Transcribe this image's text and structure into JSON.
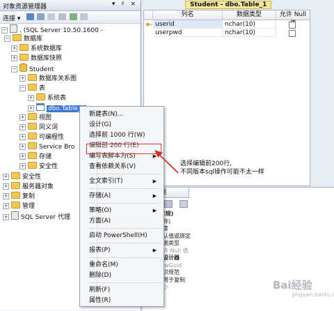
{
  "explorer": {
    "title": "对象资源管理器",
    "title_buttons": "▾ ♯ ×",
    "toolbar": {
      "connect_label": "连接 ▾"
    },
    "tree": [
      {
        "text": ". (SQL Server 10.50.1600 - ",
        "expander": "−",
        "icon": "server-icon"
      },
      {
        "text": "数据库",
        "expander": "−",
        "icon": "folder-icon"
      },
      {
        "text": "系统数据库",
        "expander": "+",
        "icon": "folder-icon"
      },
      {
        "text": "数据库快照",
        "expander": "+",
        "icon": "folder-icon"
      },
      {
        "text": "Student",
        "expander": "−",
        "icon": "database-icon"
      },
      {
        "text": "数据库关系图",
        "expander": "+",
        "icon": "folder-icon"
      },
      {
        "text": "表",
        "expander": "−",
        "icon": "folder-icon"
      },
      {
        "text": "系统表",
        "expander": "+",
        "icon": "folder-icon"
      },
      {
        "text": "dbo.Table_1",
        "expander": "+",
        "icon": "table-icon",
        "selected": true
      },
      {
        "text": "视图",
        "expander": "+",
        "icon": "folder-icon"
      },
      {
        "text": "同义词",
        "expander": "+",
        "icon": "folder-icon"
      },
      {
        "text": "可编程性",
        "expander": "+",
        "icon": "folder-icon"
      },
      {
        "text": "Service Bro",
        "expander": "+",
        "icon": "folder-icon"
      },
      {
        "text": "存储",
        "expander": "+",
        "icon": "folder-icon"
      },
      {
        "text": "安全性",
        "expander": "+",
        "icon": "folder-icon"
      },
      {
        "text": "安全性",
        "expander": "+",
        "icon": "folder-icon"
      },
      {
        "text": "服务器对象",
        "expander": "+",
        "icon": "folder-icon"
      },
      {
        "text": "复制",
        "expander": "+",
        "icon": "folder-icon"
      },
      {
        "text": "管理",
        "expander": "+",
        "icon": "folder-icon"
      },
      {
        "text": "SQL Server 代理",
        "expander": "+",
        "icon": "agent-icon"
      }
    ]
  },
  "designer": {
    "tab_title": "Student - dbo.Table_1",
    "columns": [
      "列名",
      "数据类型",
      "允许 Null 值"
    ],
    "rows": [
      {
        "name": "userid",
        "type": "nchar(10)",
        "key": true
      },
      {
        "name": "userpwd",
        "type": "nchar(10)",
        "key": false
      }
    ]
  },
  "props": {
    "tab_label": "性",
    "rows": [
      {
        "text": "(常规)",
        "style": "b"
      },
      {
        "text": "名称)",
        "style": ""
      },
      {
        "text": "长度",
        "style": ""
      },
      {
        "text": "默认值或绑定",
        "style": ""
      },
      {
        "text": "数据类型",
        "style": ""
      },
      {
        "text": "允许 Null 值",
        "style": "g"
      },
      {
        "text": "表设计器",
        "style": "b"
      },
      {
        "text": "RowGuid",
        "style": "g"
      },
      {
        "text": "标识规范",
        "style": ""
      },
      {
        "text": "不用于复制",
        "style": ""
      },
      {
        "text": "大小",
        "style": "g"
      }
    ]
  },
  "context_menu": {
    "items": [
      {
        "label": "新建表(N)...",
        "submenu": false
      },
      {
        "label": "设计(G)",
        "submenu": false
      },
      {
        "label": "选择前 1000 行(W)",
        "submenu": false
      },
      {
        "label": "编辑前 200 行(E)",
        "submenu": false,
        "highlighted": true
      },
      {
        "label": "编写表脚本为(S)",
        "submenu": true
      },
      {
        "label": "查看依赖关系(V)",
        "submenu": false
      },
      {
        "sep": true
      },
      {
        "label": "全文索引(T)",
        "submenu": true
      },
      {
        "sep": true
      },
      {
        "label": "存储(A)",
        "submenu": true
      },
      {
        "sep": true
      },
      {
        "label": "策略(O)",
        "submenu": true
      },
      {
        "label": "方面(A)",
        "submenu": false
      },
      {
        "sep": true
      },
      {
        "label": "启动 PowerShell(H)",
        "submenu": false
      },
      {
        "sep": true
      },
      {
        "label": "报表(P)",
        "submenu": true
      },
      {
        "sep": true
      },
      {
        "label": "重命名(M)",
        "submenu": false
      },
      {
        "label": "删除(D)",
        "submenu": false
      },
      {
        "sep": true
      },
      {
        "label": "刷新(F)",
        "submenu": false
      },
      {
        "label": "属性(R)",
        "submenu": false
      }
    ]
  },
  "annotation": {
    "line1": "选择编辑前200行,",
    "line2": "不同版本sql操作可能不太一样",
    "color": "#d33030"
  },
  "watermark": {
    "text": "Bai经验",
    "sub": "jingyan.baidu.com"
  },
  "colors": {
    "selection": "#3a78d6",
    "folder": "#f0c85a",
    "menu_bg": "#f5f6f8"
  }
}
